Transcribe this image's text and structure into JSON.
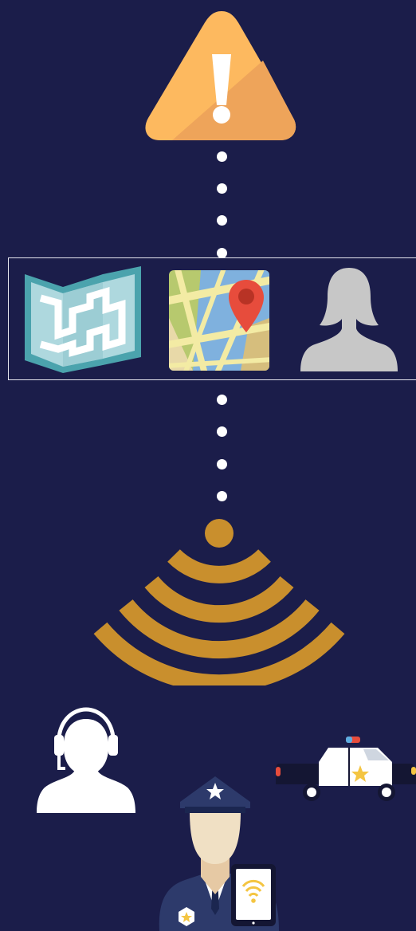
{
  "colors": {
    "background": "#1b1d4a",
    "warning_light": "#fdb95f",
    "warning_dark": "#eea45a",
    "signal": "#c98f2d",
    "dot": "#ffffff",
    "map_teal": "#4ba3ad",
    "avatar_gray": "#c7c7c7",
    "pin_red": "#e74c3c"
  },
  "icons": {
    "warning": "warning-triangle-icon",
    "paper_map": "folded-map-icon",
    "gps_map": "map-pin-icon",
    "person": "female-avatar-icon",
    "signal": "wifi-signal-icon",
    "dispatcher": "headset-operator-icon",
    "police_car": "police-car-icon",
    "officer": "police-officer-tablet-icon"
  }
}
